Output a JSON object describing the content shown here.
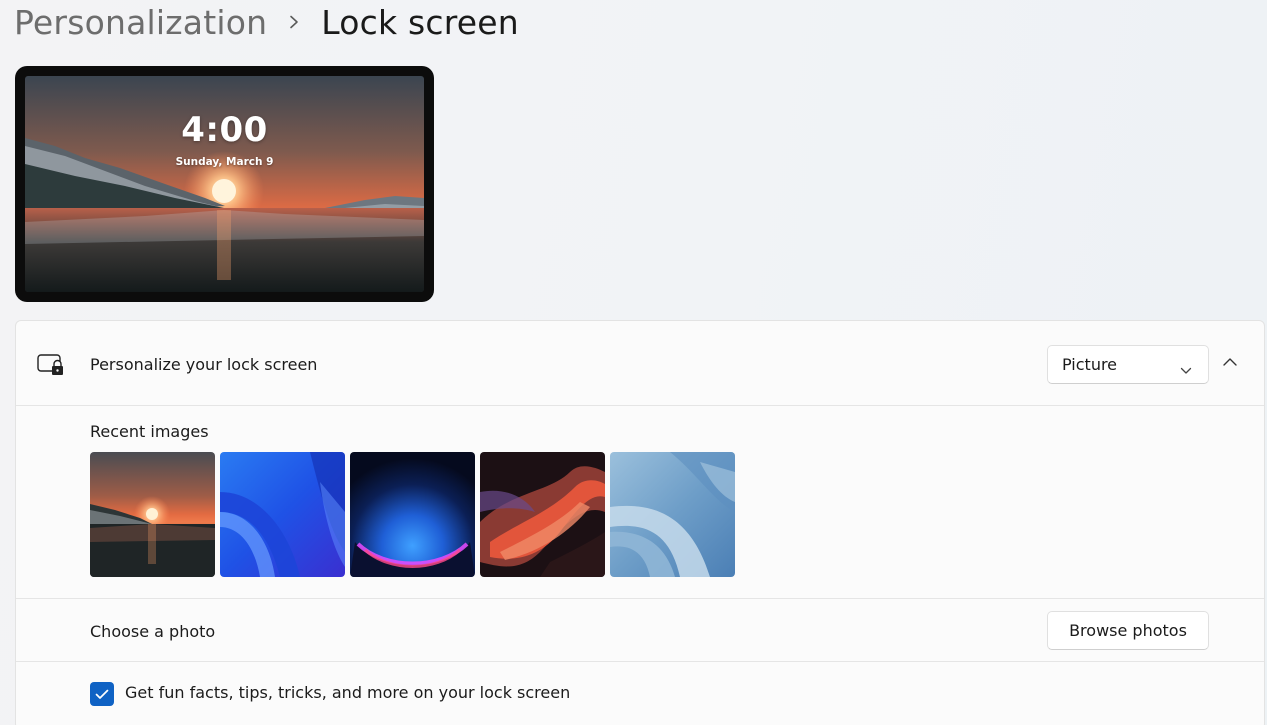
{
  "breadcrumb": {
    "parent": "Personalization",
    "current": "Lock screen",
    "separator_icon": "chevron-right-icon"
  },
  "preview": {
    "time": "4:00",
    "date": "Sunday, March 9"
  },
  "personalize": {
    "icon": "lock-screen-icon",
    "label": "Personalize your lock screen",
    "dropdown_value": "Picture",
    "collapse_icon": "chevron-up-icon"
  },
  "recent_images": {
    "label": "Recent images",
    "items": [
      {
        "name": "sunset-lake"
      },
      {
        "name": "blue-bloom"
      },
      {
        "name": "dark-glow"
      },
      {
        "name": "red-ribbon"
      },
      {
        "name": "light-blue-bloom"
      }
    ]
  },
  "choose_photo": {
    "label": "Choose a photo",
    "button": "Browse photos"
  },
  "fun_facts": {
    "label": "Get fun facts, tips, tricks, and more on your lock screen",
    "checked": true
  },
  "colors": {
    "accent": "#0f62c4",
    "card_background": "#fbfbfb",
    "page_background": "#f3f3f5"
  }
}
